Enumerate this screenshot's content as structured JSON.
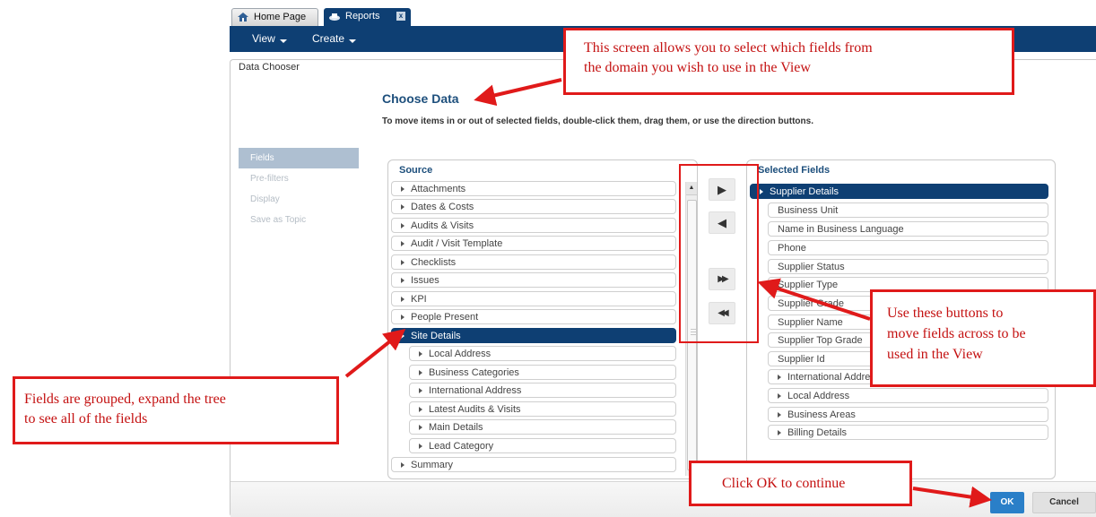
{
  "tabs": [
    {
      "label": "Home Page",
      "icon": "home-icon"
    },
    {
      "label": "Reports",
      "icon": "reports-icon",
      "close": "x"
    }
  ],
  "menubar": {
    "view": "View",
    "create": "Create"
  },
  "panel": {
    "title": "Data Chooser",
    "heading": "Choose Data",
    "instructions": "To move items in or out of selected fields, double-click them, drag them, or use the direction buttons."
  },
  "steps": [
    "Fields",
    "Pre-filters",
    "Display",
    "Save as Topic"
  ],
  "source": {
    "header": "Source",
    "items": [
      "Attachments",
      "Dates & Costs",
      "Audits & Visits",
      "Audit / Visit Template",
      "Checklists",
      "Issues",
      "KPI",
      "People Present",
      "Site Details"
    ],
    "children": [
      "Local Address",
      "Business Categories",
      "International Address",
      "Latest Audits & Visits",
      "Main Details",
      "Lead Category"
    ],
    "last": "Summary"
  },
  "selected": {
    "header": "Selected Fields",
    "group": "Supplier Details",
    "fields": [
      "Business Unit",
      "Name in Business Language",
      "Phone",
      "Supplier Status",
      "Supplier Type",
      "Supplier Grade",
      "Supplier Name",
      "Supplier Top Grade",
      "Supplier Id"
    ],
    "subgroups": [
      "International Address",
      "Local Address",
      "Business Areas",
      "Billing Details"
    ]
  },
  "direction_buttons": {
    "add": "▶",
    "remove": "◀",
    "add_all": "▶▶",
    "remove_all": "◀◀"
  },
  "footer": {
    "ok": "OK",
    "cancel": "Cancel"
  },
  "callouts": {
    "top": [
      "This screen allows you to select which fields from",
      "the domain you wish to use in the View"
    ],
    "left": [
      "Fields are grouped, expand the tree",
      "to see all of the fields"
    ],
    "right": [
      "Use these buttons to",
      "move fields  across to be",
      "used in the View"
    ],
    "ok": "Click OK to continue"
  },
  "colors": {
    "brand_navy": "#0e3f73",
    "heading_blue": "#1d4f7c",
    "callout_red": "#e01a1a",
    "ok_blue": "#2a7fc8"
  }
}
